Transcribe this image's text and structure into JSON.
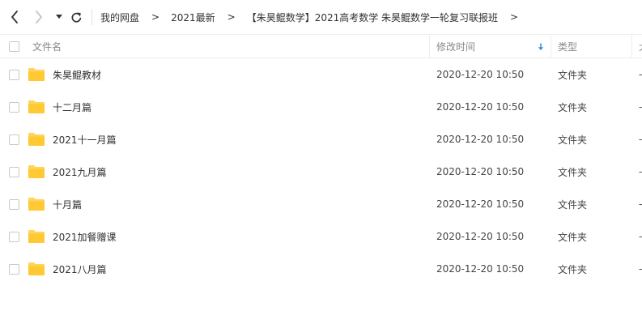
{
  "breadcrumb": {
    "items": [
      "我的网盘",
      "2021最新",
      "【朱昊鲲数学】2021高考数学 朱昊鲲数学一轮复习联报班"
    ],
    "separator": ">"
  },
  "columns": {
    "name": "文件名",
    "modified": "修改时间",
    "type": "类型",
    "size": "大"
  },
  "files": [
    {
      "name": "朱昊鲲教材",
      "modified": "2020-12-20 10:50",
      "type": "文件夹",
      "size": "-"
    },
    {
      "name": "十二月篇",
      "modified": "2020-12-20 10:50",
      "type": "文件夹",
      "size": "-"
    },
    {
      "name": "2021十一月篇",
      "modified": "2020-12-20 10:50",
      "type": "文件夹",
      "size": "-"
    },
    {
      "name": "2021九月篇",
      "modified": "2020-12-20 10:50",
      "type": "文件夹",
      "size": "-"
    },
    {
      "name": "十月篇",
      "modified": "2020-12-20 10:50",
      "type": "文件夹",
      "size": "-"
    },
    {
      "name": "2021加餐赠课",
      "modified": "2020-12-20 10:50",
      "type": "文件夹",
      "size": "-"
    },
    {
      "name": "2021八月篇",
      "modified": "2020-12-20 10:50",
      "type": "文件夹",
      "size": "-"
    }
  ],
  "icons": {
    "back": "arrow-left-icon",
    "forward": "arrow-right-icon",
    "history": "caret-down-icon",
    "refresh": "refresh-icon",
    "sort": "sort-arrow-down-icon",
    "folder": "folder-icon"
  },
  "colors": {
    "folder": "#ffd35c",
    "sort_arrow": "#2a8ff0",
    "forward_disabled": "#c4c4c4"
  }
}
